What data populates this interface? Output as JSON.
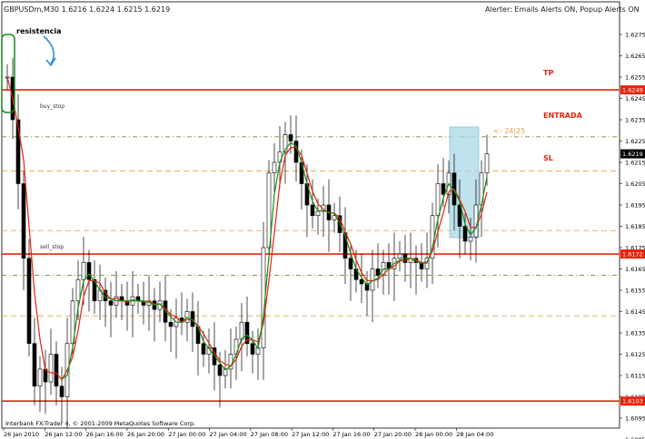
{
  "header": {
    "symbol_info": "GBPUSDm,M30  1.6216 1.6224 1.6215 1.6219",
    "alerts": "Alerter:  Emails Alerts ON,  Popup Alerts ON"
  },
  "footer": {
    "copyright": "Interbank FX-Trader 4, © 2001-2009 MetaQuotes Software Corp."
  },
  "annotations": {
    "resistencia": "resistencia",
    "tp": "TP",
    "entrada": "ENTRADA",
    "sl": "SL",
    "pips": "<- 24|25",
    "buy_stop": "buy_stop",
    "sell_stop": "sell_stop"
  },
  "price_axis": {
    "ticks": [
      "1.6275",
      "1.6265",
      "1.6255",
      "1.6245",
      "1.6235",
      "1.6225",
      "1.6215",
      "1.6205",
      "1.6195",
      "1.6185",
      "1.6175",
      "1.6165",
      "1.6155",
      "1.6145",
      "1.6135",
      "1.6125",
      "1.6115",
      "1.6105",
      "1.6095",
      "1.6085"
    ],
    "badges": [
      {
        "text": "1.6249",
        "color": "#e8230c"
      },
      {
        "text": "1.6219",
        "color": "#000000"
      },
      {
        "text": "1.6172",
        "color": "#e8230c"
      },
      {
        "text": "1.6103",
        "color": "#e8230c"
      }
    ]
  },
  "time_axis": {
    "labels": [
      "26 Jan 2010",
      "26 Jan 12:00",
      "26 Jan 16:00",
      "26 Jan 20:00",
      "27 Jan 00:00",
      "27 Jan 04:00",
      "27 Jan 08:00",
      "27 Jan 12:00",
      "27 Jan 16:00",
      "27 Jan 20:00",
      "28 Jan 00:00",
      "28 Jan 04:00"
    ]
  },
  "levels": [
    {
      "name": "tp-line",
      "price": 1.6249,
      "color": "#e8230c",
      "style": "solid"
    },
    {
      "name": "entry-line",
      "price": 1.6227,
      "color": "#6f8f3f",
      "style": "dashdot"
    },
    {
      "name": "sl-line",
      "price": 1.6172,
      "color": "#e8230c",
      "style": "solid"
    },
    {
      "name": "low-line",
      "price": 1.6103,
      "color": "#e8230c",
      "style": "solid"
    },
    {
      "name": "orange-level-1",
      "price": 1.6211,
      "color": "#e8a04a",
      "style": "dashed"
    },
    {
      "name": "orange-level-2",
      "price": 1.6183,
      "color": "#e8a04a",
      "style": "dashed"
    },
    {
      "name": "orange-level-3",
      "price": 1.6143,
      "color": "#e8a04a",
      "style": "dashed"
    },
    {
      "name": "sell-stop-line",
      "price": 1.6162,
      "color": "#6f8f3f",
      "style": "dashdot"
    }
  ],
  "colors": {
    "bull": "#ffffff",
    "bear": "#000000",
    "wick": "#000000",
    "ma_fast": "#1a8a1a",
    "ma_slow": "#e8230c",
    "box_fill": "#a9d8e8"
  }
}
